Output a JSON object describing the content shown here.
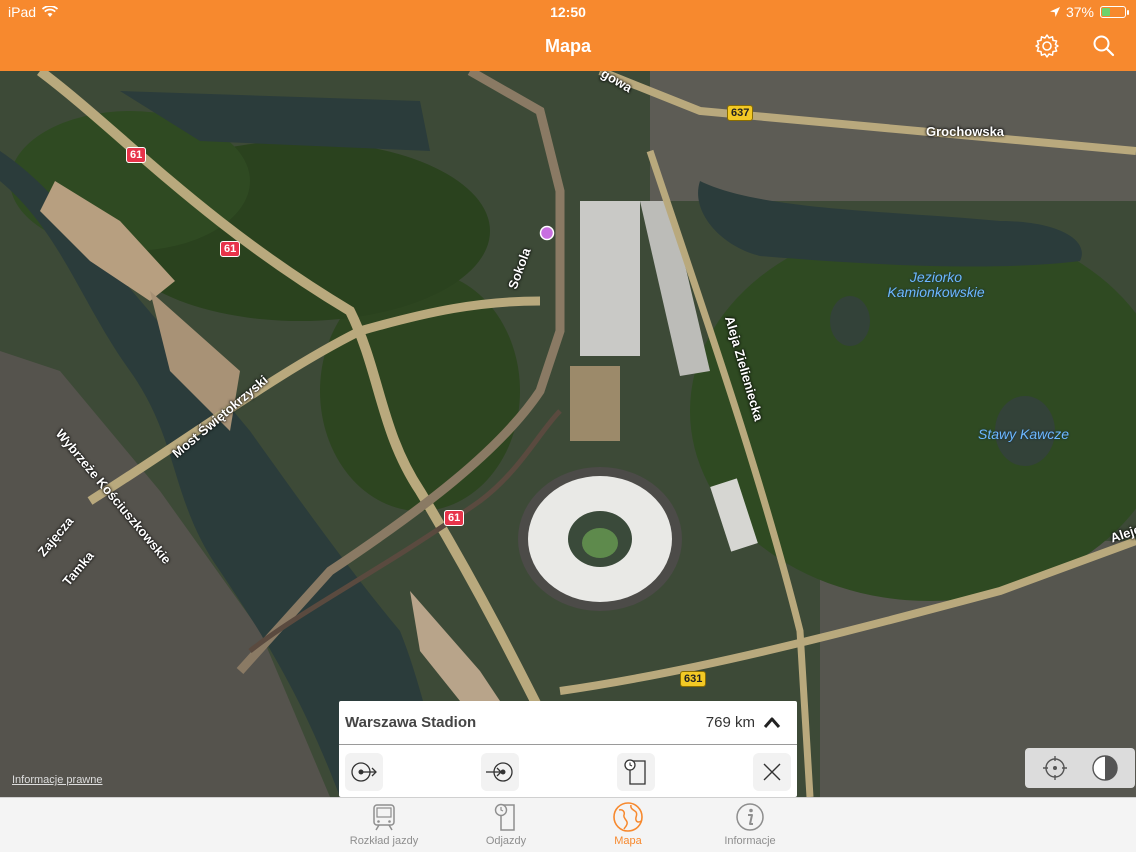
{
  "status_bar": {
    "carrier": "iPad",
    "time": "12:50",
    "battery": "37%",
    "battery_level": 0.37,
    "icons": [
      "wifi-icon",
      "location-arrow-icon",
      "battery-icon"
    ]
  },
  "nav": {
    "title": "Mapa",
    "icons": [
      "gear-icon",
      "search-icon"
    ]
  },
  "map": {
    "streets": [
      "Grochowska",
      "Sokola",
      "Aleja Zielieniecka",
      "Most Świętokrzyski",
      "Wybrzeże Kościuszkowskie",
      "Zajęcza",
      "Tamka",
      "Aleje",
      "gowa"
    ],
    "water": [
      "Jeziorko Kamionkowskie",
      "Stawy Kawcze"
    ],
    "road_numbers": [
      "61",
      "61",
      "61",
      "637",
      "631",
      "631"
    ],
    "legal_link": "Informacje prawne",
    "colors": {
      "water": "#2b3c3b",
      "vegetation": "#2f4a22",
      "pin": "#c86fe0",
      "road": "#b9a97d"
    }
  },
  "panel": {
    "station_name": "Warszawa Stadion",
    "distance": "769 km",
    "actions": [
      "depart-from-icon",
      "arrive-to-icon",
      "timetable-icon",
      "close-icon"
    ]
  },
  "map_controls": [
    "locate-icon",
    "map-mode-icon"
  ],
  "tabs": [
    {
      "label": "Rozkład jazdy",
      "icon": "train-icon",
      "active": false
    },
    {
      "label": "Odjazdy",
      "icon": "departures-icon",
      "active": false
    },
    {
      "label": "Mapa",
      "icon": "globe-icon",
      "active": true
    },
    {
      "label": "Informacje",
      "icon": "info-icon",
      "active": false
    }
  ],
  "accent": "#f7892e"
}
